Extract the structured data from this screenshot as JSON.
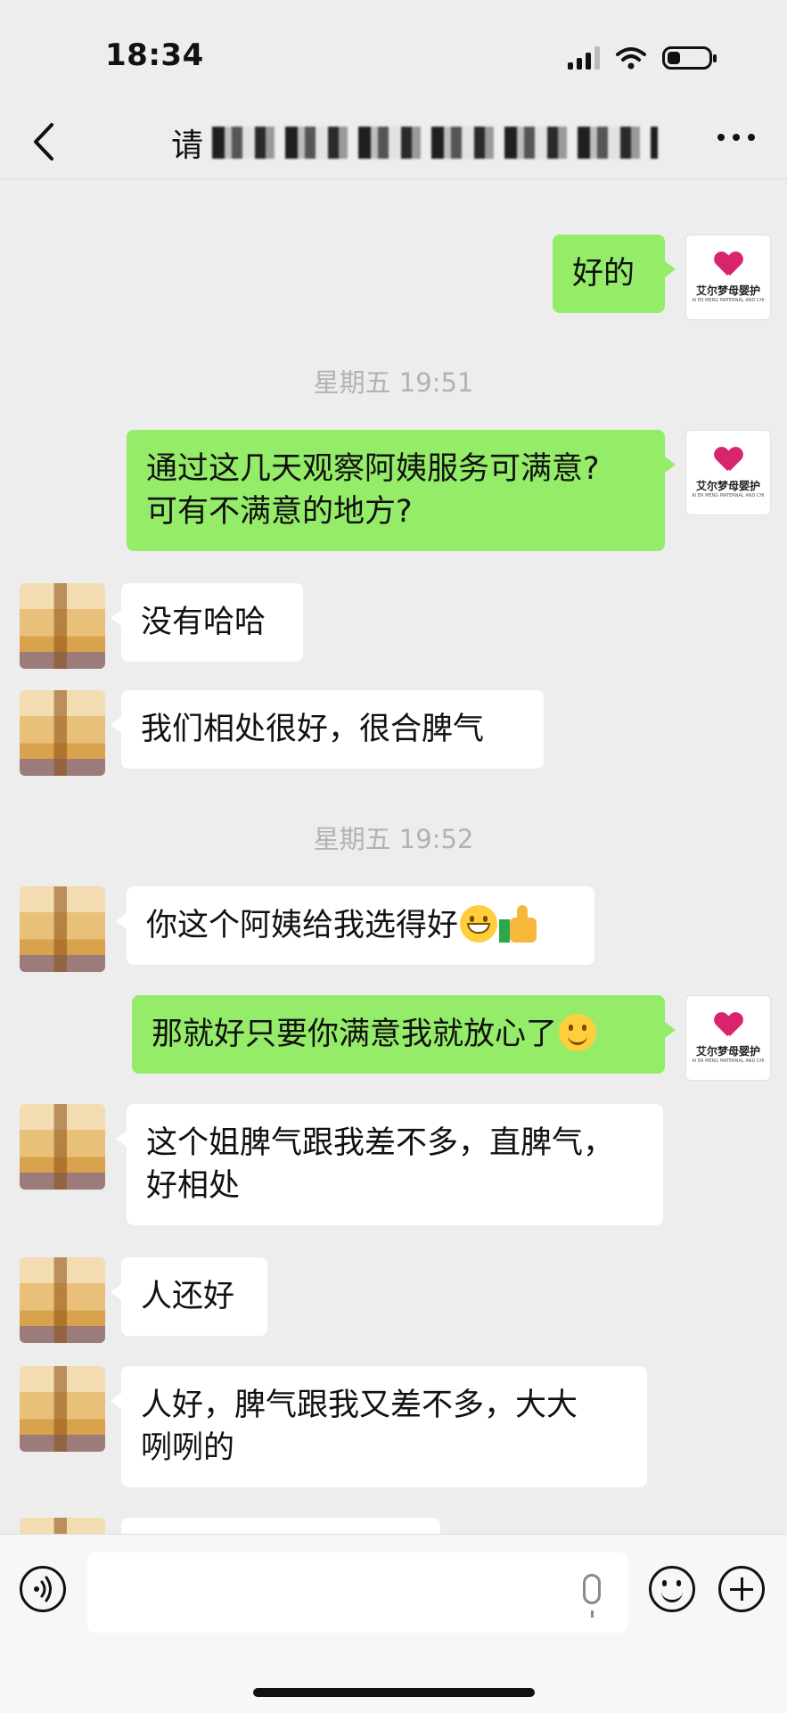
{
  "status_bar": {
    "time": "18:34"
  },
  "header": {
    "title_prefix": "请"
  },
  "messages": [
    {
      "type": "timestamp",
      "text": "星期五 19:51"
    },
    {
      "type": "timestamp",
      "text": "星期五 19:52"
    }
  ],
  "chat": {
    "m_reply_ok": "好的",
    "ts_1": "星期五 19:51",
    "m_ask_line1": "通过这几天观察阿姨服务可满意?",
    "m_ask_line2": "可有不满意的地方?",
    "m_no": "没有哈哈",
    "m_get_along": "我们相处很好，很合脾气",
    "ts_2": "星期五 19:52",
    "m_chose_well": "你这个阿姨给我选得好",
    "m_relieved": "那就好只要你满意我就放心了",
    "m_sister_line1": "这个姐脾气跟我差不多，直脾气，",
    "m_sister_line2": "好相处",
    "m_nice": "人还好",
    "m_nice2_line1": "人好，脾气跟我又差不多，大大",
    "m_nice2_line2": "咧咧的"
  },
  "brand": {
    "logo_cn": "艾尔梦母婴护",
    "logo_en": "AI ER MENG MATERNAL AND CHI",
    "accent_color": "#d8246d",
    "bubble_outgoing_color": "#95ec69",
    "bubble_incoming_color": "#ffffff"
  },
  "icons": {
    "back": "chevron-left-icon",
    "more": "ellipsis-icon",
    "voice": "voice-icon",
    "mic": "microphone-icon",
    "emoji": "emoji-icon",
    "plus": "plus-icon"
  }
}
